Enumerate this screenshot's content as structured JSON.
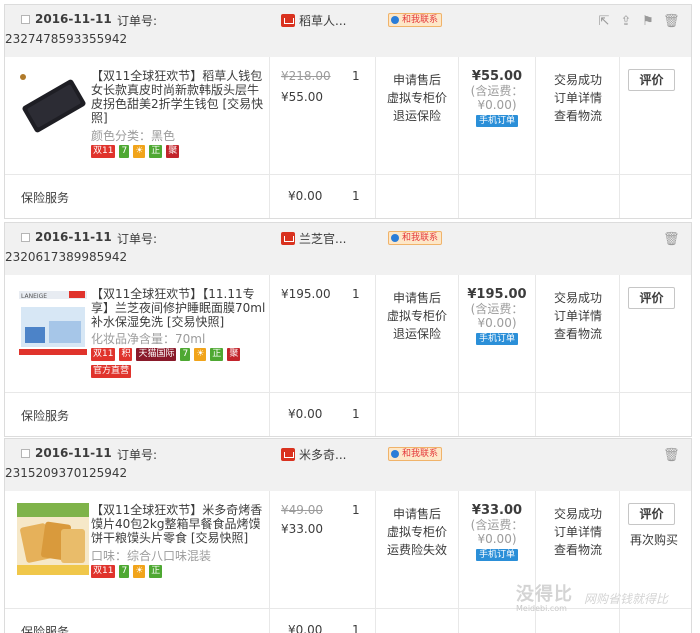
{
  "orders": [
    {
      "date": "2016-11-11",
      "order_label": "订单号:",
      "order_number": "2327478593355942",
      "shop": "稻草人...",
      "contact": "和我联系",
      "title": "【双11全球狂欢节】稻草人钱包女长款真皮时尚新款韩版头层牛皮拐色甜美2折学生钱包 [交易快照]",
      "attr": "颜色分类：黑色",
      "tags": [
        "双11",
        "7",
        "",
        "正",
        "聚"
      ],
      "orig_price": "¥218.00",
      "price": "¥55.00",
      "qty": "1",
      "services": [
        "申请售后",
        "虚拟专柜价",
        "退运保险"
      ],
      "total": "¥55.00",
      "ship": "(含运费：¥0.00)",
      "mobile": "手机订单",
      "status": [
        "交易成功",
        "订单详情",
        "查看物流"
      ],
      "rate": "评价",
      "rebuy": "",
      "ins_label": "保险服务",
      "ins_price": "¥0.00",
      "ins_qty": "1"
    },
    {
      "date": "2016-11-11",
      "order_label": "订单号:",
      "order_number": "2320617389985942",
      "shop": "兰芝官...",
      "contact": "和我联系",
      "title": "【双11全球狂欢节】【11.11专享】兰芝夜间修护睡眠面膜70ml 补水保湿免洗 [交易快照]",
      "attr": "化妆品净含量：70ml",
      "tags": [
        "双11",
        "积",
        "天猫国际",
        "7",
        "",
        "正",
        "聚",
        "官方直营"
      ],
      "orig_price": "",
      "price": "¥195.00",
      "qty": "1",
      "services": [
        "申请售后",
        "虚拟专柜价",
        "退运保险"
      ],
      "total": "¥195.00",
      "ship": "(含运费：¥0.00)",
      "mobile": "手机订单",
      "status": [
        "交易成功",
        "订单详情",
        "查看物流"
      ],
      "rate": "评价",
      "rebuy": "",
      "ins_label": "保险服务",
      "ins_price": "¥0.00",
      "ins_qty": "1"
    },
    {
      "date": "2016-11-11",
      "order_label": "订单号:",
      "order_number": "2315209370125942",
      "shop": "米多奇...",
      "contact": "和我联系",
      "title": "【双11全球狂欢节】米多奇烤香馍片40包2kg整箱早餐食品烤馍饼干粮馍头片零食 [交易快照]",
      "attr": "口味：综合八口味混装",
      "tags": [
        "双11",
        "7",
        "",
        "正"
      ],
      "orig_price": "¥49.00",
      "price": "¥33.00",
      "qty": "1",
      "services": [
        "申请售后",
        "虚拟专柜价",
        "运费险失效"
      ],
      "total": "¥33.00",
      "ship": "(含运费：¥0.00)",
      "mobile": "手机订单",
      "status": [
        "交易成功",
        "订单详情",
        "查看物流"
      ],
      "rate": "评价",
      "rebuy": "再次购买",
      "ins_label": "保险服务",
      "ins_price": "¥0.00",
      "ins_qty": "1"
    }
  ],
  "watermark": {
    "main": "没得比",
    "sub": "Meidebi.com",
    "slogan": "网购省钱就得比"
  },
  "colors": {
    "accent_red": "#e4393c",
    "mobile_blue": "#2b8fd8",
    "header_bg": "#f1f1f1"
  }
}
